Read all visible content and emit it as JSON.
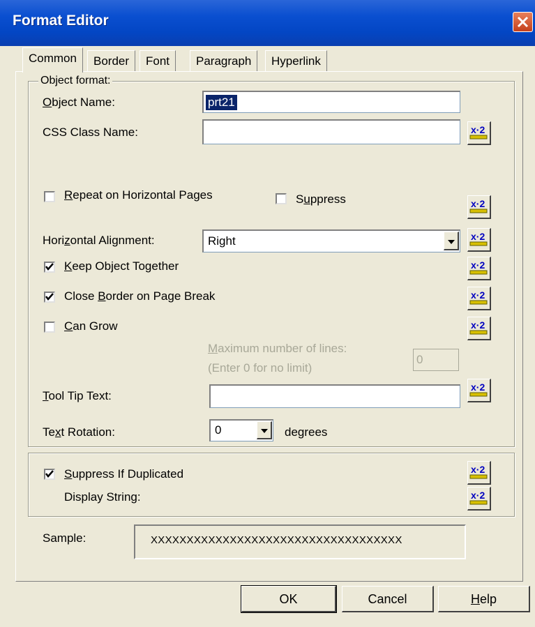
{
  "window": {
    "title": "Format Editor"
  },
  "tabs": [
    {
      "label": "Common",
      "active": true
    },
    {
      "label": "Border",
      "active": false
    },
    {
      "label": "Font",
      "active": false
    },
    {
      "label": "Paragraph",
      "active": false
    },
    {
      "label": "Hyperlink",
      "active": false
    }
  ],
  "object_format": {
    "group_label": "Object format:",
    "object_name_label": "Object Name:",
    "object_name_value": "prt21",
    "css_class_label": "CSS Class Name:",
    "css_class_value": "",
    "repeat_label": "Repeat on Horizontal Pages",
    "repeat_checked": false,
    "suppress_label": "Suppress",
    "suppress_checked": false,
    "halign_label": "Horizontal Alignment:",
    "halign_value": "Right",
    "keep_together_label": "Keep Object Together",
    "keep_together_checked": true,
    "close_border_label": "Close Border on Page Break",
    "close_border_checked": true,
    "can_grow_label": "Can Grow",
    "can_grow_checked": false,
    "max_lines_label": "Maximum number of lines:",
    "max_lines_hint": "(Enter 0 for no limit)",
    "max_lines_value": "0",
    "tooltip_label": "Tool Tip Text:",
    "tooltip_value": "",
    "rotation_label": "Text Rotation:",
    "rotation_value": "0",
    "rotation_unit": "degrees"
  },
  "duplicates": {
    "suppress_dup_label": "Suppress If Duplicated",
    "suppress_dup_checked": true,
    "display_string_label": "Display String:"
  },
  "sample": {
    "label": "Sample:",
    "value": "XXXXXXXXXXXXXXXXXXXXXXXXXXXXXXXXXXX"
  },
  "buttons": {
    "ok": "OK",
    "cancel": "Cancel",
    "help": "Help"
  },
  "icons": {
    "formula": "x-2 formula-icon",
    "close": "close-icon",
    "checkmark": "checkmark-icon",
    "dropdown": "dropdown-arrow-icon"
  }
}
